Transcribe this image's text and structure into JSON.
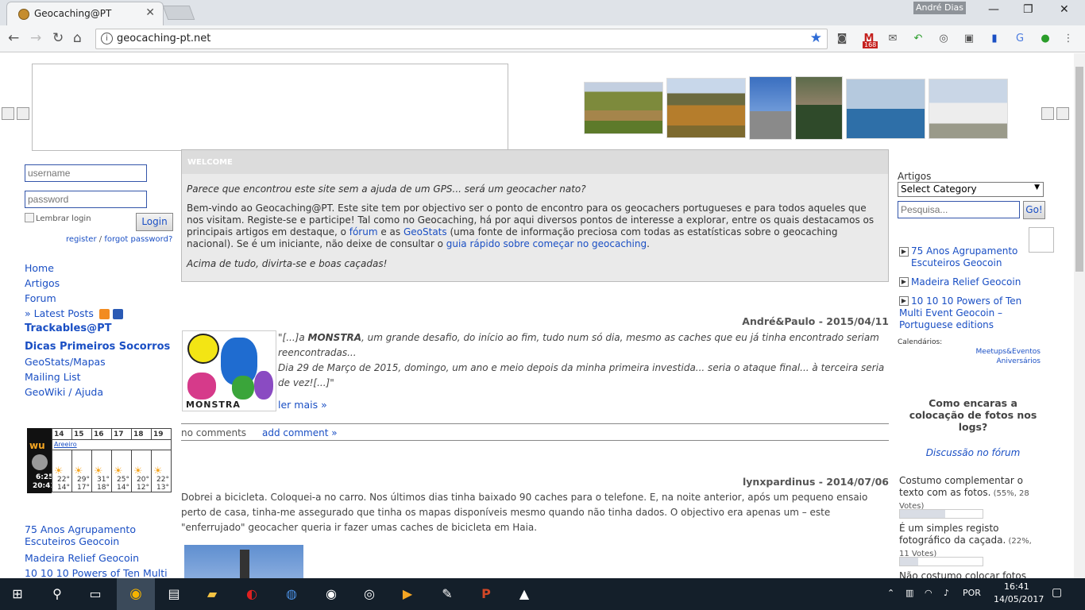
{
  "browser": {
    "tab_title": "Geocaching@PT",
    "tab_close": "✕",
    "user": "André Dias",
    "url": "geocaching-pt.net",
    "gmail_badge": "168"
  },
  "login": {
    "username_placeholder": "username",
    "password_placeholder": "password",
    "remember": "Lembrar login",
    "login_btn": "Login",
    "register": "register",
    "sep": "/",
    "forgot": "forgot password?"
  },
  "nav": {
    "items": [
      "Home",
      "Artigos",
      "Forum",
      "» Latest Posts"
    ],
    "trackables": "Trackables@PT",
    "bold2": "Dicas Primeiros Socorros",
    "items2": [
      "GeoStats/Mapas",
      "Mailing List",
      "GeoWiki / Ajuda"
    ]
  },
  "weather": {
    "days": [
      "14",
      "15",
      "16",
      "17",
      "18",
      "19"
    ],
    "place": "Areeiro",
    "sunrise": "6:25",
    "sunset": "20:41",
    "highs": [
      "22°",
      "29°",
      "31°",
      "25°",
      "20°",
      "22°"
    ],
    "lows": [
      "14°",
      "17°",
      "18°",
      "14°",
      "12°",
      "13°"
    ]
  },
  "left_links": [
    "75 Anos Agrupamento Escuteiros Geocoin",
    "Madeira Relief Geocoin",
    "10 10 10 Powers of Ten Multi"
  ],
  "welcome": {
    "title": "WELCOME",
    "p1": "Parece que encontrou este site sem a ajuda de um GPS... será um geocacher nato?",
    "p2a": "Bem-vindo ao Geocaching@PT. Este site tem por objectivo ser o ponto de encontro para os geocachers portugueses e para todos aqueles que nos visitam. Registe-se e participe! Tal como no Geocaching, há por aqui diversos pontos de interesse a explorar, entre os quais destacamos os principais artigos em destaque, o ",
    "forum": "fórum",
    "and": " e as ",
    "geostats": "GeoStats",
    "p2b": " (uma fonte de informação preciosa com todas as estatísticas sobre o geocaching nacional). Se é um iniciante, não deixe de consultar o ",
    "guide": "guia rápido sobre começar no geocaching",
    "dot": ".",
    "p3": "Acima de tudo, divirta-se e boas caçadas!"
  },
  "post1": {
    "header": "André&Paulo - 2015/04/11",
    "q1": "\"[...]a ",
    "q1b": "MONSTRA",
    "q1c": ", um grande desafio, do início ao fim, tudo num só dia, mesmo as caches que eu já tinha encontrado seriam reencontradas...",
    "q2": "Dia 29 de Março de 2015, domingo, um ano e meio depois da minha primeira investida... seria o ataque final... à terceira seria de vez![...]\"",
    "more": "ler mais »",
    "comments": "no comments",
    "add": "add comment »",
    "logo_text": "MONSTRA"
  },
  "post2": {
    "header": "lynxpardinus - 2014/07/06",
    "text": "Dobrei a bicicleta. Coloquei-a no carro. Nos últimos dias tinha baixado 90 caches para o telefone. E, na noite anterior, após um pequeno ensaio perto de casa, tinha-me assegurado que tinha os mapas disponíveis mesmo quando não tinha dados. O objectivo era apenas um – este \"enferrujado\" geocacher queria ir fazer umas caches de bicicleta em Haia."
  },
  "right": {
    "artigos": "Artigos",
    "select": "Select Category",
    "search_placeholder": "Pesquisa...",
    "go": "Go!",
    "links": [
      "75 Anos Agrupamento Escuteiros Geocoin",
      "Madeira Relief Geocoin",
      "10 10 10 Powers of Ten Multi Event Geocoin – Portuguese editions"
    ],
    "cal_label": "Calendários:",
    "cal1": "Meetups&Eventos",
    "cal2": "Aniversários",
    "poll_q": "Como encaras a colocação de fotos nos logs?",
    "poll_link": "Discussão no fórum",
    "opt1": "Costumo complementar o texto com as fotos.",
    "opt1v": " (55%, 28 Votes)",
    "opt1_share": 0.55,
    "opt2": "É um simples registo fotográfico da caçada.",
    "opt2v": " (22%, 11 Votes)",
    "opt2_share": 0.22,
    "opt3": "Não costumo colocar fotos"
  },
  "taskbar": {
    "lang": "POR",
    "time": "16:41",
    "date": "14/05/2017"
  }
}
